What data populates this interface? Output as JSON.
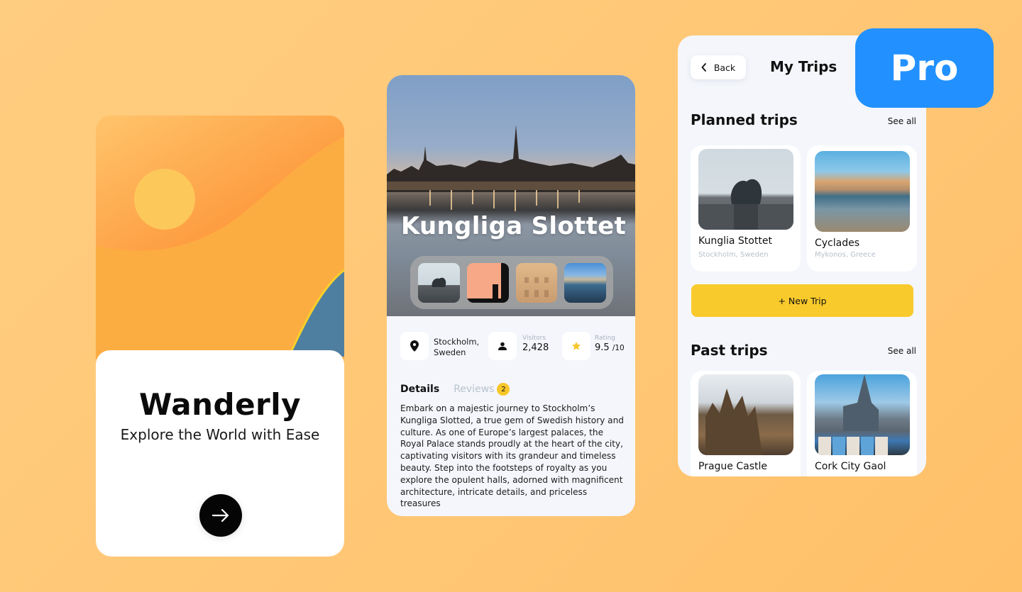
{
  "onboarding": {
    "title": "Wanderly",
    "subtitle": "Explore the World with Ease",
    "next_icon": "arrow-right-icon",
    "colors": {
      "sun": "#fdc85a",
      "dune": "#fcad42",
      "sky": "#fd8a35",
      "sea": "#4f7fa0",
      "accent_line": "#f9cf2a"
    }
  },
  "detail": {
    "title": "Kungliga Slottet",
    "thumbnails": [
      "statue-photo",
      "sunset-silhouette-photo",
      "palace-facade-photo",
      "harbor-photo"
    ],
    "stats": {
      "location": {
        "icon": "map-pin-icon",
        "value": "Stockholm,\nSweden",
        "line1": "Stockholm,",
        "line2": "Sweden"
      },
      "visitors": {
        "icon": "user-icon",
        "label": "Visitors",
        "value": "2,428"
      },
      "rating": {
        "icon": "star-icon",
        "label": "Rating",
        "value": "9.5",
        "unit": "/10"
      }
    },
    "tabs": {
      "details": "Details",
      "reviews": "Reviews",
      "reviews_count": "2"
    },
    "description": "Embark on a majestic journey to Stockholm’s Kungliga Slotted, a true gem of Swedish history and culture. As one of Europe’s largest palaces, the Royal Palace stands proudly at the heart of the city, captivating visitors with its grandeur and timeless beauty. Step into the footsteps of royalty as you explore the opulent halls, adorned with magnificent architecture, intricate details, and priceless treasures"
  },
  "trips": {
    "back_label": "Back",
    "title": "My Trips",
    "planned": {
      "title": "Planned trips",
      "see_all": "See all",
      "items": [
        {
          "name": "Kunglia Stottet",
          "location": "Stockholm, Sweden"
        },
        {
          "name": "Cyclades",
          "location": "Mykonos, Greece"
        }
      ]
    },
    "new_trip_label": "+ New Trip",
    "past": {
      "title": "Past trips",
      "see_all": "See all",
      "items": [
        {
          "name": "Prague Castle"
        },
        {
          "name": "Cork City Gaol"
        }
      ]
    }
  },
  "pro_badge": {
    "label": "Pro",
    "color": "#2291ff"
  }
}
